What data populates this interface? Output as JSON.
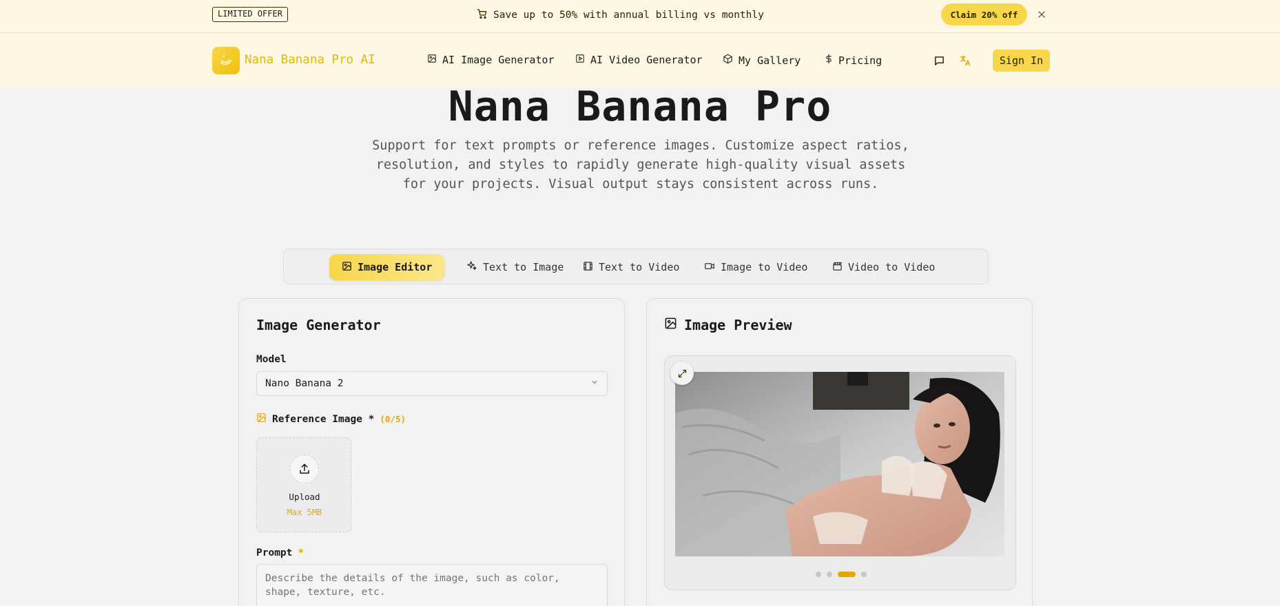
{
  "promo": {
    "badge": "LIMITED OFFER",
    "message": "Save up to 50% with annual billing vs monthly",
    "claim_label": "Claim 20% off"
  },
  "nav": {
    "brand": "Nana Banana Pro AI",
    "links": [
      {
        "label": "AI Image Generator",
        "icon": "image-icon"
      },
      {
        "label": "AI Video Generator",
        "icon": "video-play-icon"
      },
      {
        "label": "My Gallery",
        "icon": "cube-icon"
      },
      {
        "label": "Pricing",
        "icon": "dollar-icon"
      }
    ],
    "sign_in": "Sign In"
  },
  "hero": {
    "title": "Nana Banana Pro",
    "subtitle": "Support for text prompts or reference images. Customize aspect ratios, resolution, and styles to rapidly generate high-quality visual assets for your projects. Visual output stays consistent across runs."
  },
  "tabs": [
    {
      "label": "Image Editor",
      "icon": "image-icon",
      "active": true
    },
    {
      "label": "Text to Image",
      "icon": "sparkles-icon",
      "active": false
    },
    {
      "label": "Text to Video",
      "icon": "film-icon",
      "active": false
    },
    {
      "label": "Image to Video",
      "icon": "camera-icon",
      "active": false
    },
    {
      "label": "Video to Video",
      "icon": "clapper-icon",
      "active": false
    }
  ],
  "generator": {
    "title": "Image Generator",
    "model_label": "Model",
    "model_value": "Nano Banana 2",
    "ref_label": "Reference Image *",
    "ref_count": "(0/5)",
    "upload_label": "Upload",
    "upload_limit": "Max 5MB",
    "prompt_label": "Prompt",
    "prompt_required": "*",
    "prompt_placeholder": "Describe the details of the image, such as color, shape, texture, etc."
  },
  "preview": {
    "title": "Image Preview",
    "slides_total": 4,
    "active_slide": 3
  },
  "colors": {
    "accent": "#f7d64a",
    "accent_text": "#e6a800",
    "banner_bg": "#fdf8e4",
    "page_bg": "#f2f2f2"
  }
}
